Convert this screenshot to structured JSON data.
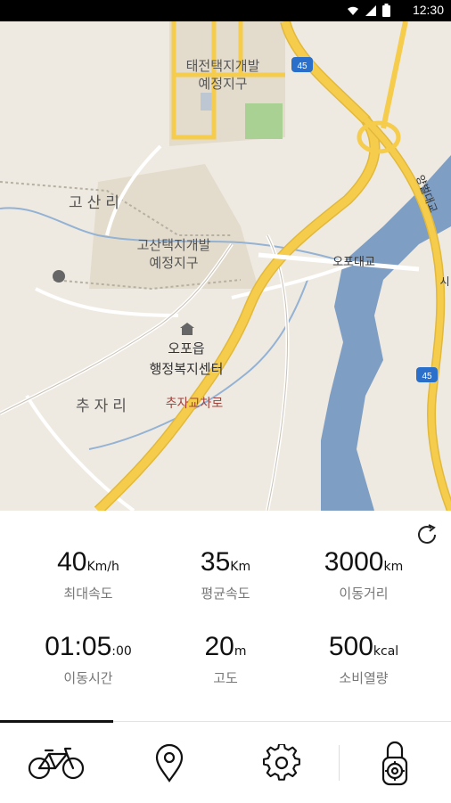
{
  "status_bar": {
    "time": "12:30"
  },
  "map": {
    "labels": {
      "district_top_1": "태전택지개발",
      "district_top_2": "예정지구",
      "village_gosan": "고산리",
      "district_mid_1": "고산택지개발",
      "district_mid_2": "예정지구",
      "office_1": "오포읍",
      "office_2": "행정복지센터",
      "village_chuja": "추자리",
      "intersection": "추자교차로",
      "bridge": "오포대교",
      "bridge_vertical": "양벌대교",
      "route_top": "45",
      "route_right": "45",
      "edge_label": "시"
    }
  },
  "stats": {
    "max_speed": {
      "value": "40",
      "unit": "Km/h",
      "label": "최대속도"
    },
    "avg_speed": {
      "value": "35",
      "unit": "Km",
      "label": "평균속도"
    },
    "distance": {
      "value": "3000",
      "unit": "km",
      "label": "이동거리"
    },
    "duration": {
      "value": "01:05",
      "unit": ":00",
      "label": "이동시간"
    },
    "altitude": {
      "value": "20",
      "unit": "m",
      "label": "고도"
    },
    "calories": {
      "value": "500",
      "unit": "kcal",
      "label": "소비열량"
    }
  },
  "tabs": [
    {
      "icon": "bicycle-icon",
      "active": true
    },
    {
      "icon": "location-pin-icon",
      "active": false
    },
    {
      "icon": "gear-icon",
      "active": false
    },
    {
      "icon": "lock-icon",
      "active": false
    }
  ],
  "colors": {
    "road_major": "#f6cc4d",
    "river": "#7f9ec3",
    "map_bg": "#efeae1",
    "green_area": "#a9d194"
  }
}
